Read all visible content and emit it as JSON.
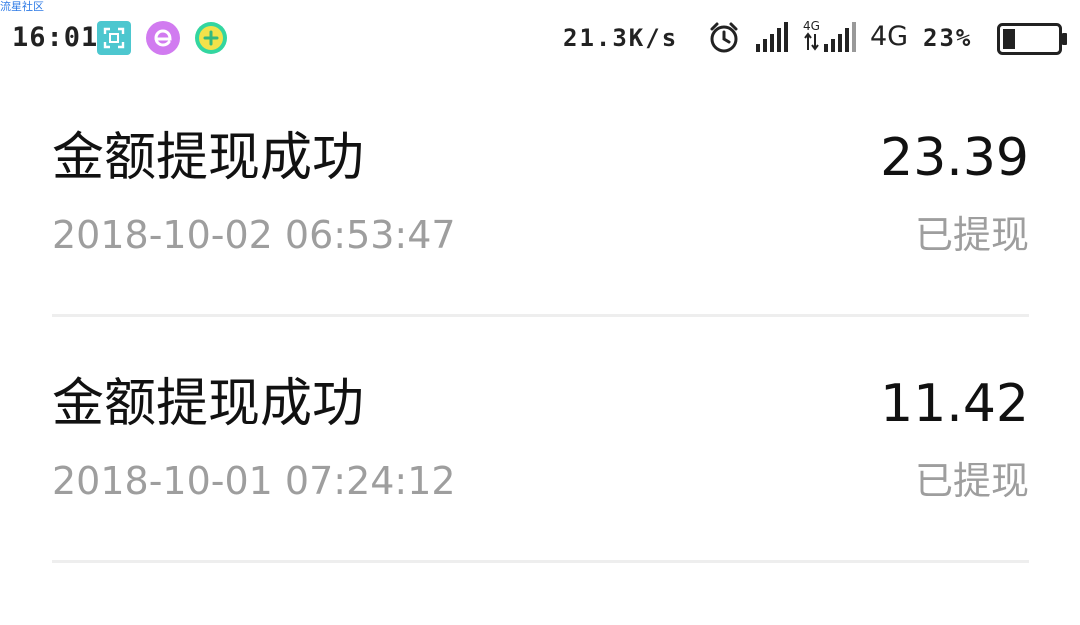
{
  "watermark": "流星社区",
  "status_bar": {
    "time": "16:01",
    "net_speed": "21.3K/s",
    "network_type": "4G",
    "network_type_small": "4G",
    "battery_percent": "23%",
    "battery_level": 0.23,
    "apps": [
      "scan-app-icon",
      "browser-e-app-icon",
      "plus-app-icon"
    ]
  },
  "records": [
    {
      "title": "金额提现成功",
      "amount": "23.39",
      "time": "2018-10-02 06:53:47",
      "status": "已提现"
    },
    {
      "title": "金额提现成功",
      "amount": "11.42",
      "time": "2018-10-01 07:24:12",
      "status": "已提现"
    }
  ],
  "colors": {
    "primary_text": "#111111",
    "secondary_text": "#9e9e9e",
    "divider": "#eeeeee",
    "scan_icon": "#4dc7cf",
    "e_icon": "#d17bf0",
    "plus_icon_ring": "#33d6a0",
    "plus_icon_fill": "#f2e24a"
  }
}
